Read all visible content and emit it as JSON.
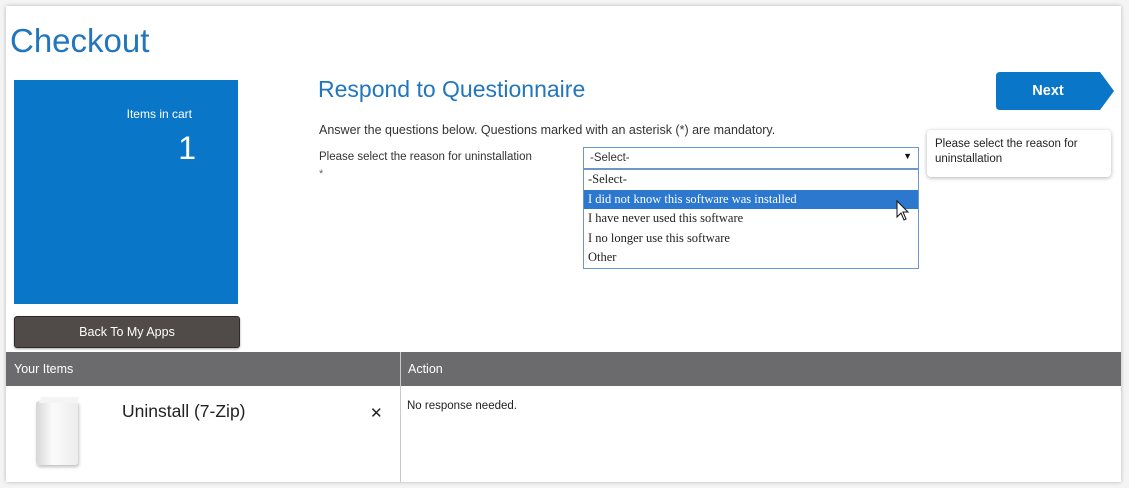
{
  "page": {
    "title": "Checkout"
  },
  "cart": {
    "label": "Items in cart",
    "count": "1"
  },
  "back_button": {
    "label": "Back To My Apps"
  },
  "questionnaire": {
    "title": "Respond to Questionnaire",
    "instructions": "Answer the questions below. Questions marked with an asterisk (*) are mandatory.",
    "question_label": "Please select the reason for uninstallation",
    "required_marker": "*",
    "select": {
      "selected": "-Select-",
      "options": [
        "-Select-",
        "I did not know this software was installed",
        "I have never used this software",
        "I no longer use this software",
        "Other"
      ],
      "highlighted_index": 1
    }
  },
  "next_button": {
    "label": "Next"
  },
  "tooltip": {
    "text": "Please select the reason for uninstallation"
  },
  "table": {
    "headers": {
      "items": "Your Items",
      "action": "Action"
    },
    "rows": [
      {
        "name": "Uninstall (7-Zip)",
        "remove": "✕",
        "action": "No response needed."
      }
    ]
  },
  "colors": {
    "accent": "#2176bd",
    "tile": "#0a76c8",
    "header": "#6b6b6d",
    "highlight": "#2c78cf"
  },
  "icons": {
    "remove": "close-icon",
    "dropdown": "chevron-down-icon",
    "pointer": "mouse-pointer-icon"
  }
}
